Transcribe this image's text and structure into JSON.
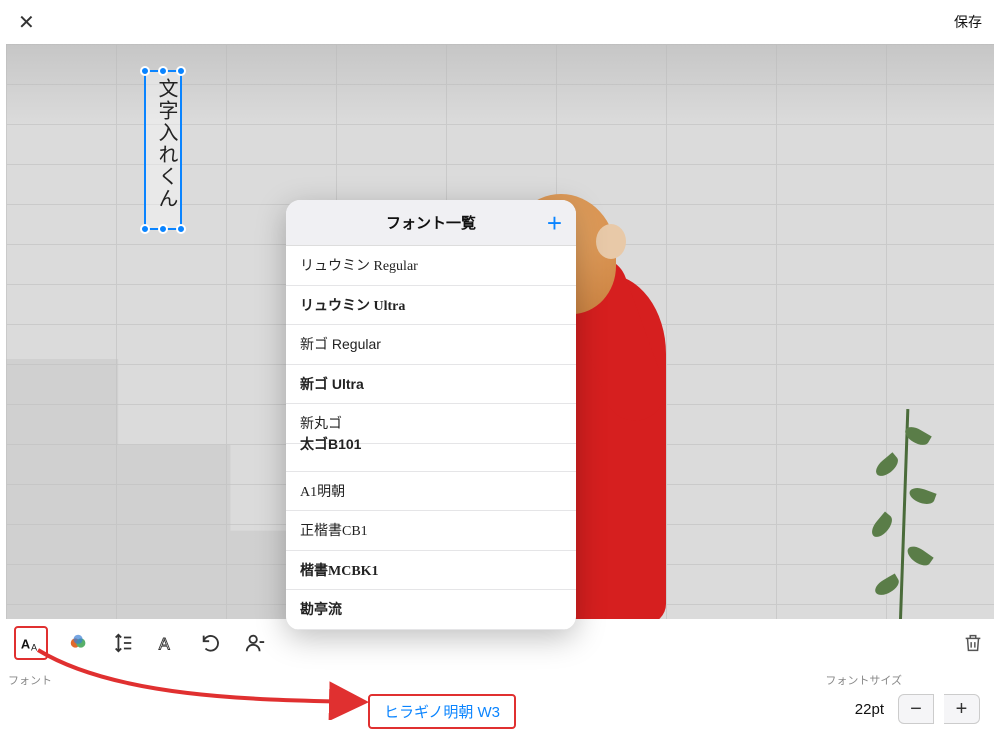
{
  "header": {
    "save_label": "保存"
  },
  "textbox": {
    "content": "文字入れくん"
  },
  "popover": {
    "title": "フォント一覧",
    "items": [
      {
        "label": "リュウミン Regular",
        "style": "serif"
      },
      {
        "label": "リュウミン Ultra",
        "style": "serif bold"
      },
      {
        "label": "新ゴ Regular",
        "style": ""
      },
      {
        "label": "新ゴ Ultra",
        "style": "bold"
      },
      {
        "label": "新丸ゴ",
        "style": ""
      },
      {
        "label": "太ゴB101",
        "style": "bold cut"
      },
      {
        "label": "A1明朝",
        "style": "serif"
      },
      {
        "label": "正楷書CB1",
        "style": "serif"
      },
      {
        "label": "楷書MCBK1",
        "style": "serif bold"
      },
      {
        "label": "勘亭流",
        "style": "serif bold"
      }
    ]
  },
  "toolbar": {
    "font_label": "フォント",
    "size_label": "フォントサイズ"
  },
  "font_selector": {
    "current": "ヒラギノ明朝 W3"
  },
  "font_size": {
    "value": "22pt"
  }
}
